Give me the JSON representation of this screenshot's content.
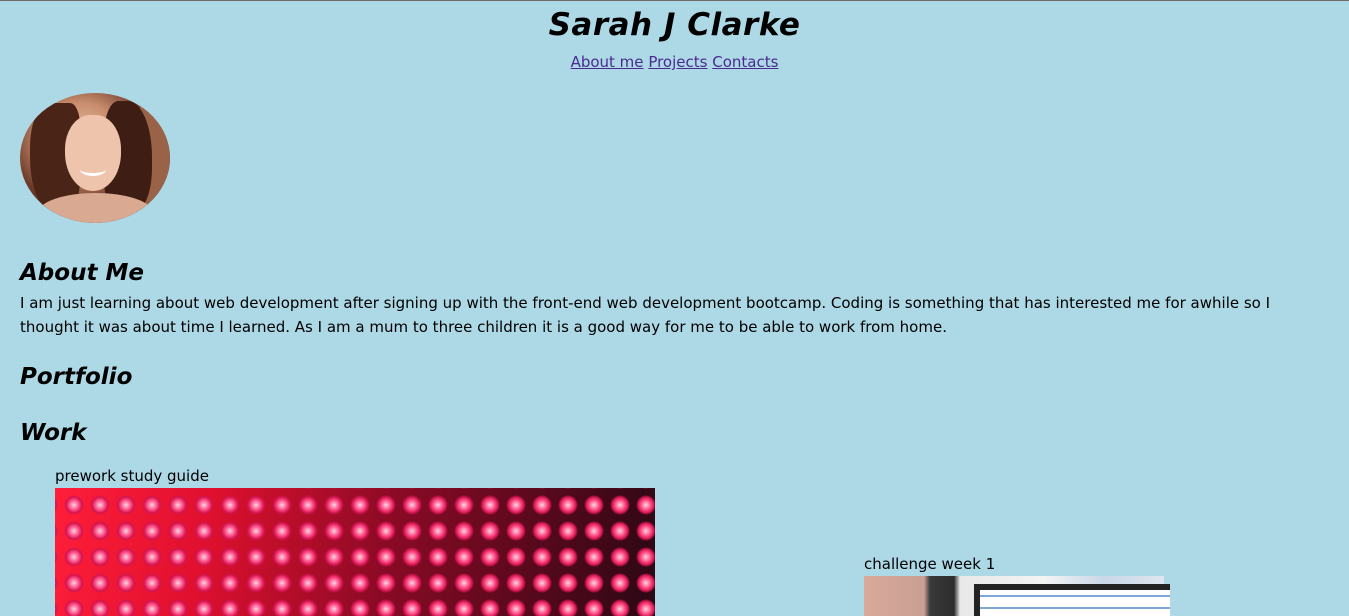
{
  "header": {
    "title": "Sarah J Clarke",
    "nav": [
      "About me",
      "Projects",
      "Contacts"
    ]
  },
  "about": {
    "heading": "About Me",
    "text": "I am just learning about web development after signing up with the front-end web development bootcamp. Coding is something that has interested me for awhile so I thought it was about time I learned. As I am a mum to three children it is a good way for me to be able to work from home."
  },
  "portfolio": {
    "heading": "Portfolio"
  },
  "work": {
    "heading": "Work",
    "items": [
      {
        "label": "prework study guide",
        "image": "red-led-lights-image"
      },
      {
        "label": "challenge week 1",
        "image": "laptop-screen-image"
      }
    ]
  },
  "colors": {
    "background": "#add8e6",
    "link": "#4b2a8f"
  }
}
